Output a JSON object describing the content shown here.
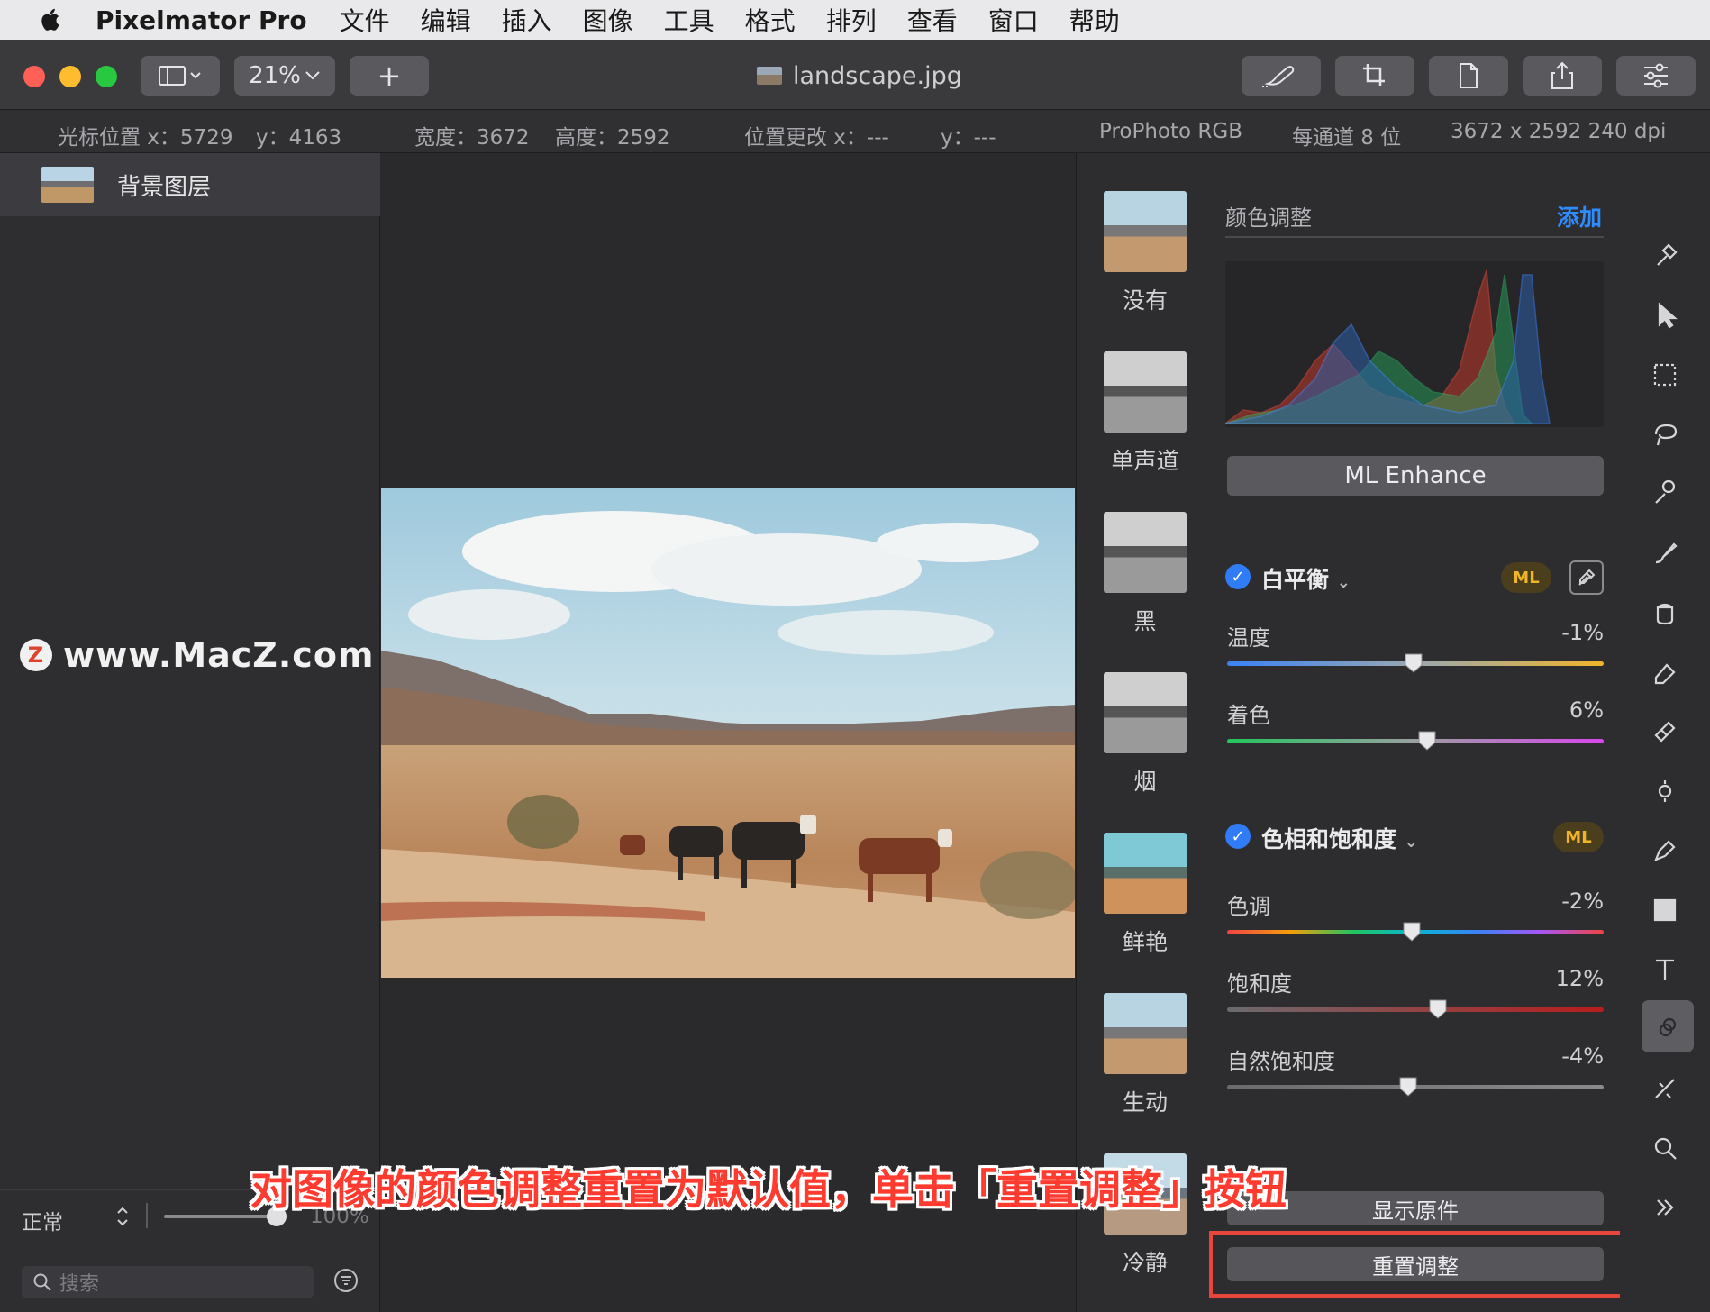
{
  "menubar": {
    "app_name": "Pixelmator Pro",
    "items": [
      "文件",
      "编辑",
      "插入",
      "图像",
      "工具",
      "格式",
      "排列",
      "查看",
      "窗口",
      "帮助"
    ]
  },
  "toolbar": {
    "zoom": "21%",
    "add_label": "+",
    "document_title": "landscape.jpg"
  },
  "infobar": {
    "cursor_x": "光标位置 x：5729",
    "cursor_y": "y：4163",
    "width": "宽度：3672",
    "height": "高度：2592",
    "move_x": "位置更改 x：---",
    "move_y": "y：---",
    "color_profile": "ProPhoto RGB",
    "bit_depth": "每通道 8 位",
    "size_dpi": "3672 x 2592 240 dpi"
  },
  "layers": {
    "items": [
      {
        "name": "背景图层"
      }
    ],
    "blend_mode": "正常",
    "opacity": "100%",
    "search_placeholder": "搜索"
  },
  "watermark": {
    "logo": "Z",
    "text": "www.MacZ.com"
  },
  "presets": [
    {
      "label": "没有"
    },
    {
      "label": "单声道"
    },
    {
      "label": "黑"
    },
    {
      "label": "烟"
    },
    {
      "label": "鲜艳"
    },
    {
      "label": "生动"
    },
    {
      "label": "冷静"
    }
  ],
  "adjustments": {
    "section_title": "颜色调整",
    "add_label": "添加",
    "ml_enhance_label": "ML Enhance",
    "white_balance": {
      "title": "白平衡",
      "ml_badge": "ML",
      "sliders": [
        {
          "label": "温度",
          "value": "-1%",
          "level": -0.01
        },
        {
          "label": "着色",
          "value": "6%",
          "level": 0.06
        }
      ]
    },
    "hue_saturation": {
      "title": "色相和饱和度",
      "ml_badge": "ML",
      "sliders": [
        {
          "label": "色调",
          "value": "-2%",
          "level": -0.02
        },
        {
          "label": "饱和度",
          "value": "12%",
          "level": 0.12
        },
        {
          "label": "自然饱和度",
          "value": "-4%",
          "level": -0.04
        }
      ]
    },
    "show_original_label": "显示原件",
    "reset_label": "重置调整"
  },
  "caption": "对图像的颜色调整重置为默认值，单击「重置调整」按钮",
  "colors": {
    "accent": "#2f7cf6",
    "highlight": "#e8453c",
    "ml_badge": "#f0b429"
  }
}
